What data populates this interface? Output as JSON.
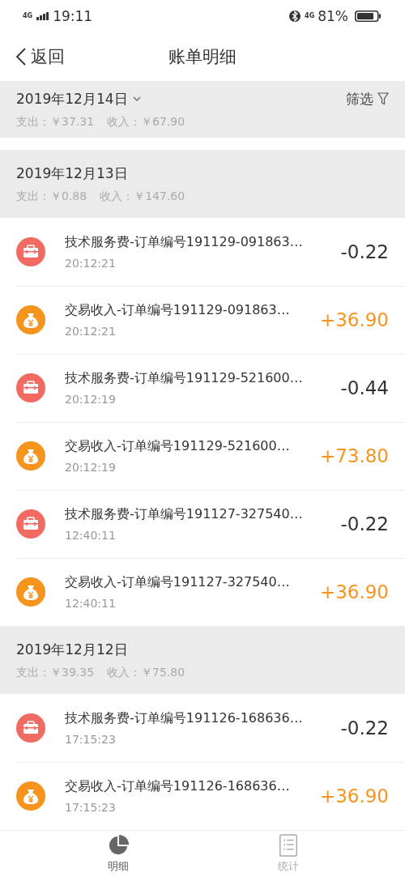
{
  "status_bar": {
    "network": "4G",
    "time": "19:11",
    "network_right": "4G",
    "battery": "81%"
  },
  "nav": {
    "back": "返回",
    "title": "账单明细"
  },
  "month_header": {
    "date": "2019年12月14日",
    "expense": "支出：￥37.31",
    "income": "收入：￥67.90",
    "filter": "筛选"
  },
  "groups": [
    {
      "date": "2019年12月13日",
      "expense": "支出：￥0.88",
      "income": "收入：￥147.60",
      "transactions": [
        {
          "kind": "fee",
          "title": "技术服务费-订单编号191129-091863…",
          "time": "20:12:21",
          "amount": "-0.22"
        },
        {
          "kind": "income",
          "title": "交易收入-订单编号191129-091863…",
          "time": "20:12:21",
          "amount": "+36.90"
        },
        {
          "kind": "fee",
          "title": "技术服务费-订单编号191129-521600…",
          "time": "20:12:19",
          "amount": "-0.44"
        },
        {
          "kind": "income",
          "title": "交易收入-订单编号191129-521600…",
          "time": "20:12:19",
          "amount": "+73.80"
        },
        {
          "kind": "fee",
          "title": "技术服务费-订单编号191127-327540…",
          "time": "12:40:11",
          "amount": "-0.22"
        },
        {
          "kind": "income",
          "title": "交易收入-订单编号191127-327540…",
          "time": "12:40:11",
          "amount": "+36.90"
        }
      ]
    },
    {
      "date": "2019年12月12日",
      "expense": "支出：￥39.35",
      "income": "收入：￥75.80",
      "transactions": [
        {
          "kind": "fee",
          "title": "技术服务费-订单编号191126-168636…",
          "time": "17:15:23",
          "amount": "-0.22"
        },
        {
          "kind": "income",
          "title": "交易收入-订单编号191126-168636…",
          "time": "17:15:23",
          "amount": "+36.90"
        }
      ]
    }
  ],
  "tab_bar": [
    {
      "label": "明细",
      "selected": true,
      "kind": "detail"
    },
    {
      "label": "统计",
      "selected": false,
      "kind": "stats"
    }
  ]
}
